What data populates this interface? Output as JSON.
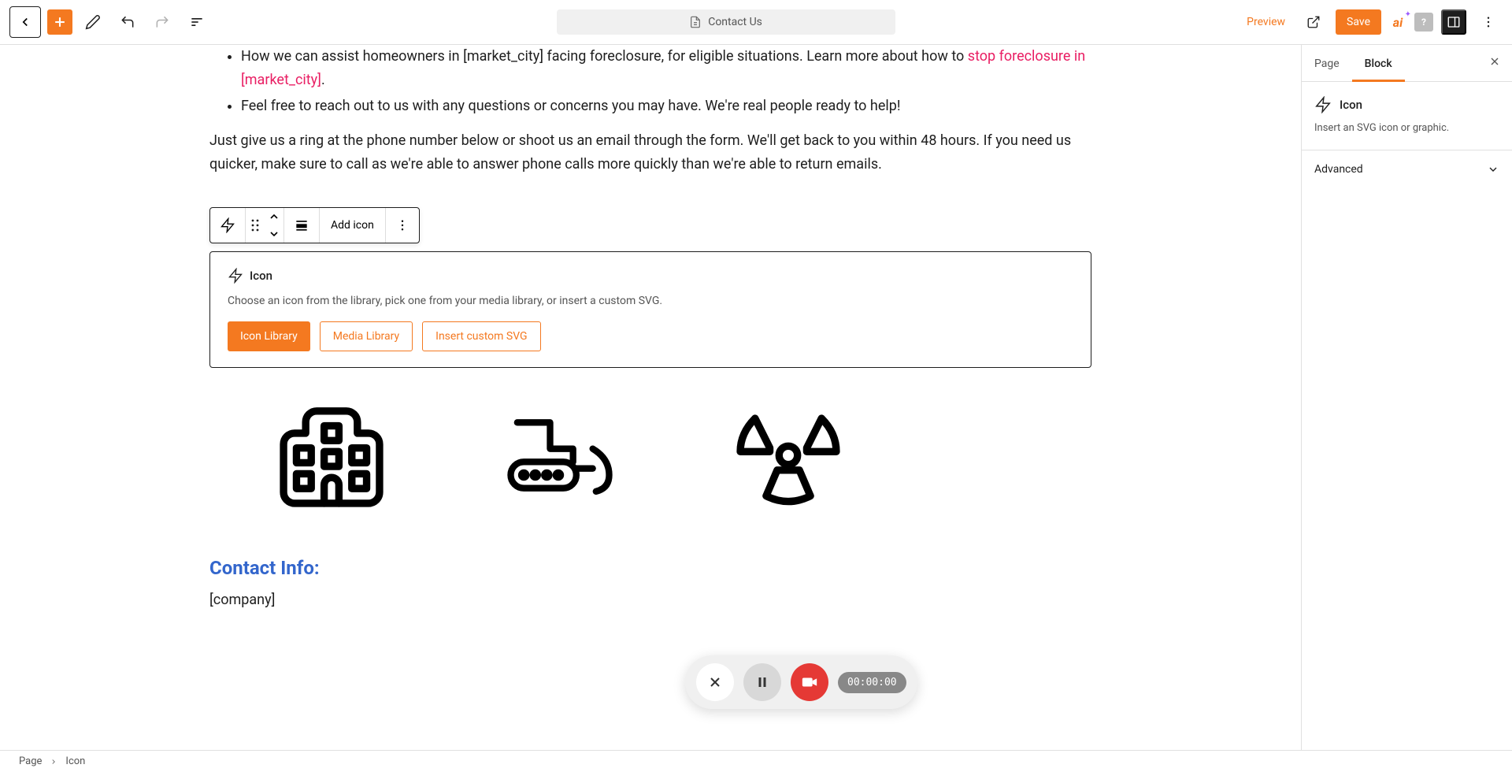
{
  "toolbar": {
    "document_title": "Contact Us",
    "preview": "Preview",
    "save": "Save"
  },
  "content": {
    "bullet1_prefix": "How we can assist homeowners in [market_city] facing foreclosure, for eligible situations. Learn more about how to ",
    "bullet1_link": "stop foreclosure in [market_city]",
    "bullet1_suffix": ".",
    "bullet2": "Feel free to reach out to us with any questions or concerns you may have. We're real people ready to help!",
    "paragraph": "Just give us a ring at the phone number below or shoot us an email through the form. We'll get back to you within 48 hours. If you need us quicker, make sure to call as we're able to answer phone calls more quickly than we're able to return emails.",
    "contact_heading": "Contact Info:",
    "company": "[company]"
  },
  "block_toolbar": {
    "add_icon": "Add icon"
  },
  "placeholder": {
    "title": "Icon",
    "desc": "Choose an icon from the library, pick one from your media library, or insert a custom SVG.",
    "btn_library": "Icon Library",
    "btn_media": "Media Library",
    "btn_svg": "Insert custom SVG"
  },
  "sidebar": {
    "tab_page": "Page",
    "tab_block": "Block",
    "block_name": "Icon",
    "block_desc": "Insert an SVG icon or graphic.",
    "advanced": "Advanced"
  },
  "breadcrumb": {
    "root": "Page",
    "current": "Icon"
  },
  "recorder": {
    "time": "00:00:00"
  }
}
